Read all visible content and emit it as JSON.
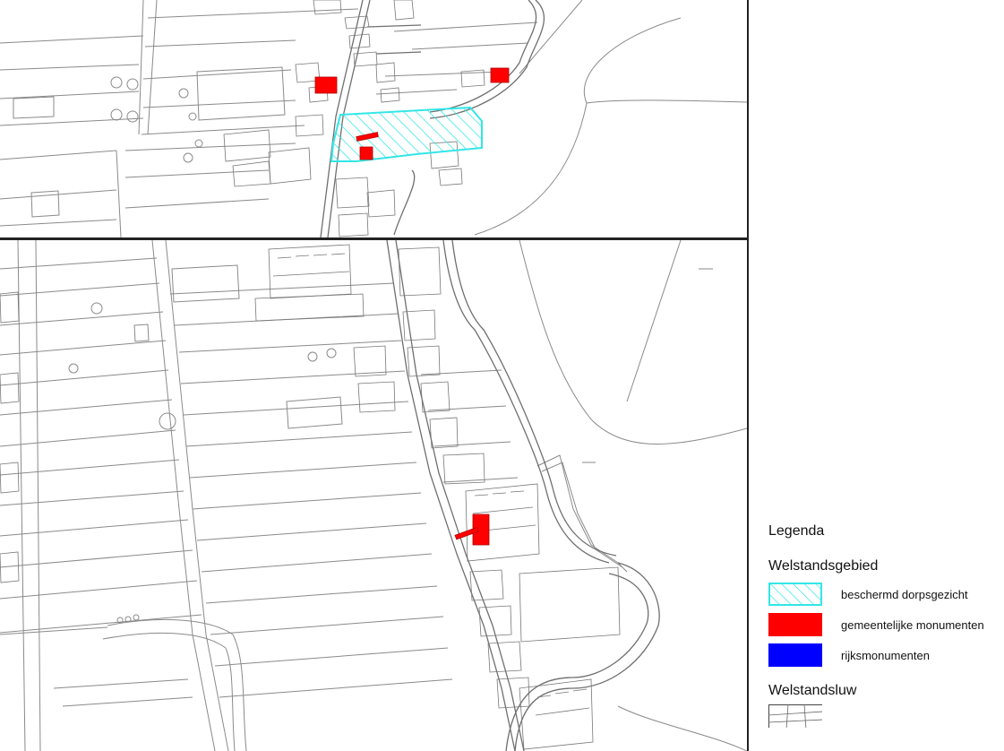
{
  "legend": {
    "title": "Legenda",
    "section_welstandsgebied": "Welstandsgebied",
    "items": [
      {
        "label": "beschermd dorpsgezicht",
        "color": "#33e6e6",
        "pattern": "hatched"
      },
      {
        "label": "gemeentelijke monumenten",
        "color": "#ff0000",
        "pattern": "solid"
      },
      {
        "label": "rijksmonumenten",
        "color": "#0000ff",
        "pattern": "solid"
      }
    ],
    "section_welstandsluw": "Welstandsluw",
    "welstandsluw_swatch": {
      "pattern": "parcel-lines",
      "color": "#555555"
    }
  },
  "colors": {
    "parcel_line": "#8a8a8a",
    "road_line": "#6f6f6f",
    "protected_outline": "#33e6e6",
    "municipal_monument": "#ff0000",
    "national_monument": "#0000ff",
    "frame": "#222222"
  }
}
